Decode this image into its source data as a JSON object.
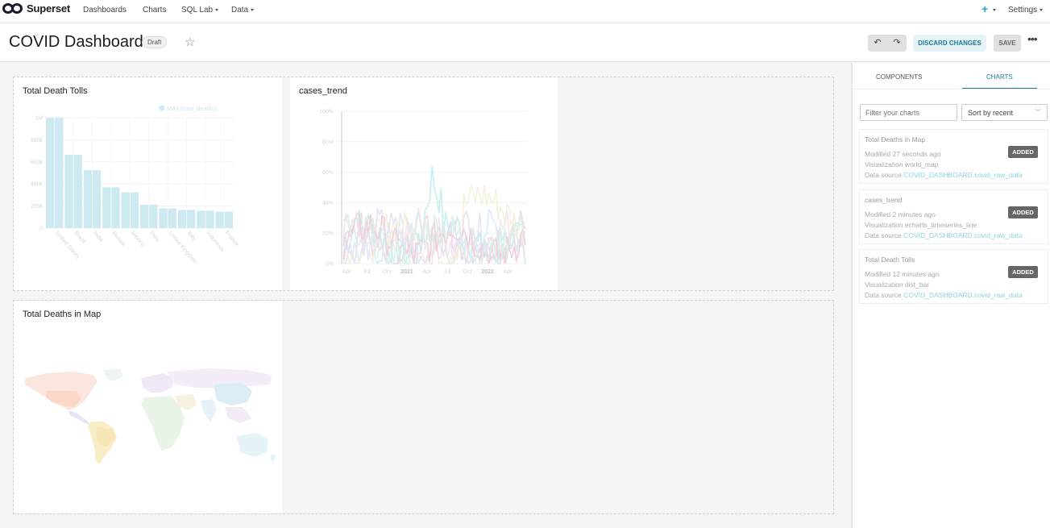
{
  "nav": {
    "logo_text": "Superset",
    "items": [
      "Dashboards",
      "Charts",
      "SQL Lab",
      "Data"
    ],
    "plus_label": "+",
    "settings_label": "Settings"
  },
  "header": {
    "title": "COVID Dashboard",
    "status": "Draft",
    "undo_symbol": "↶",
    "redo_symbol": "↷",
    "discard_label": "DISCARD CHANGES",
    "save_label": "SAVE",
    "more_symbol": "•••"
  },
  "charts": {
    "death_tolls": {
      "title": "Total Death Tolls",
      "chart_data": {
        "type": "bar",
        "legend": "MAX(total_deaths)",
        "categories": [
          "United States",
          "Brazil",
          "India",
          "Russia",
          "Mexico",
          "Peru",
          "United Kingdom",
          "Italy",
          "Indonesia",
          "France"
        ],
        "values": [
          1000000,
          665000,
          525000,
          370000,
          325000,
          212000,
          178000,
          165000,
          157000,
          150000
        ],
        "y_ticks": [
          "0",
          "200k",
          "400k",
          "600k",
          "800k",
          "1M"
        ],
        "ylim": [
          0,
          1000000
        ],
        "color": "#cdeaf3"
      }
    },
    "cases_trend": {
      "title": "cases_trend",
      "chart_data": {
        "type": "line",
        "y_ticks": [
          "0%",
          "20%",
          "40%",
          "60%",
          "80%",
          "100%"
        ],
        "x_ticks": [
          "Apr",
          "Jul",
          "Oct",
          "2021",
          "Apr",
          "Jul",
          "Oct",
          "2022",
          "Apr"
        ],
        "ylim": [
          0,
          100
        ]
      }
    },
    "deaths_map": {
      "title": "Total Deaths in Map"
    }
  },
  "panel": {
    "tabs": [
      "COMPONENTS",
      "CHARTS"
    ],
    "filter_placeholder": "Filter your charts",
    "sort_value": "Sort by recent",
    "items": [
      {
        "title": "Total Deaths in Map",
        "modified": "Modified 27 seconds ago",
        "viz": "Visualization world_map",
        "source_label": "Data source",
        "source": "COVID_DASHBOARD.covid_raw_data",
        "badge": "ADDED"
      },
      {
        "title": "cases_trend",
        "modified": "Modified 2 minutes ago",
        "viz": "Visualization echarts_timeseries_line",
        "source_label": "Data source",
        "source": "COVID_DASHBOARD.covid_raw_data",
        "badge": "ADDED"
      },
      {
        "title": "Total Death Tolls",
        "modified": "Modified 12 minutes ago",
        "viz": "Visualization dist_bar",
        "source_label": "Data source",
        "source": "COVID_DASHBOARD.covid_raw_data",
        "badge": "ADDED"
      }
    ]
  }
}
